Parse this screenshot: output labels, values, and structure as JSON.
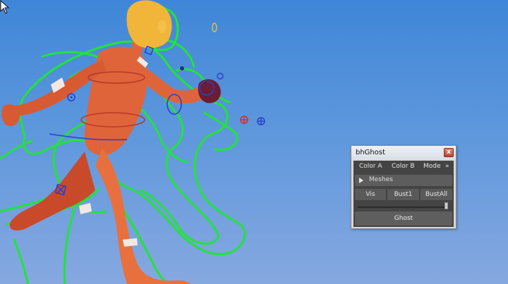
{
  "window": {
    "title": "bhGhost",
    "close_glyph": "x",
    "menu": [
      "Color A",
      "Color B",
      "Mode"
    ],
    "menu_overflow": "»",
    "frame_label": "Meshes",
    "buttons": [
      "Vis",
      "Bust1",
      "BustAll"
    ],
    "slider_level": 1.0,
    "ghost_button": "Ghost"
  },
  "viewport": {
    "subject": "character-run-icon",
    "ghost_outline_color": "#22e33a",
    "body_color": "#e0643a",
    "head_color": "#f1b53a",
    "controls": [
      "orient-circle-icon",
      "locator-icon",
      "locator-red-icon"
    ]
  }
}
